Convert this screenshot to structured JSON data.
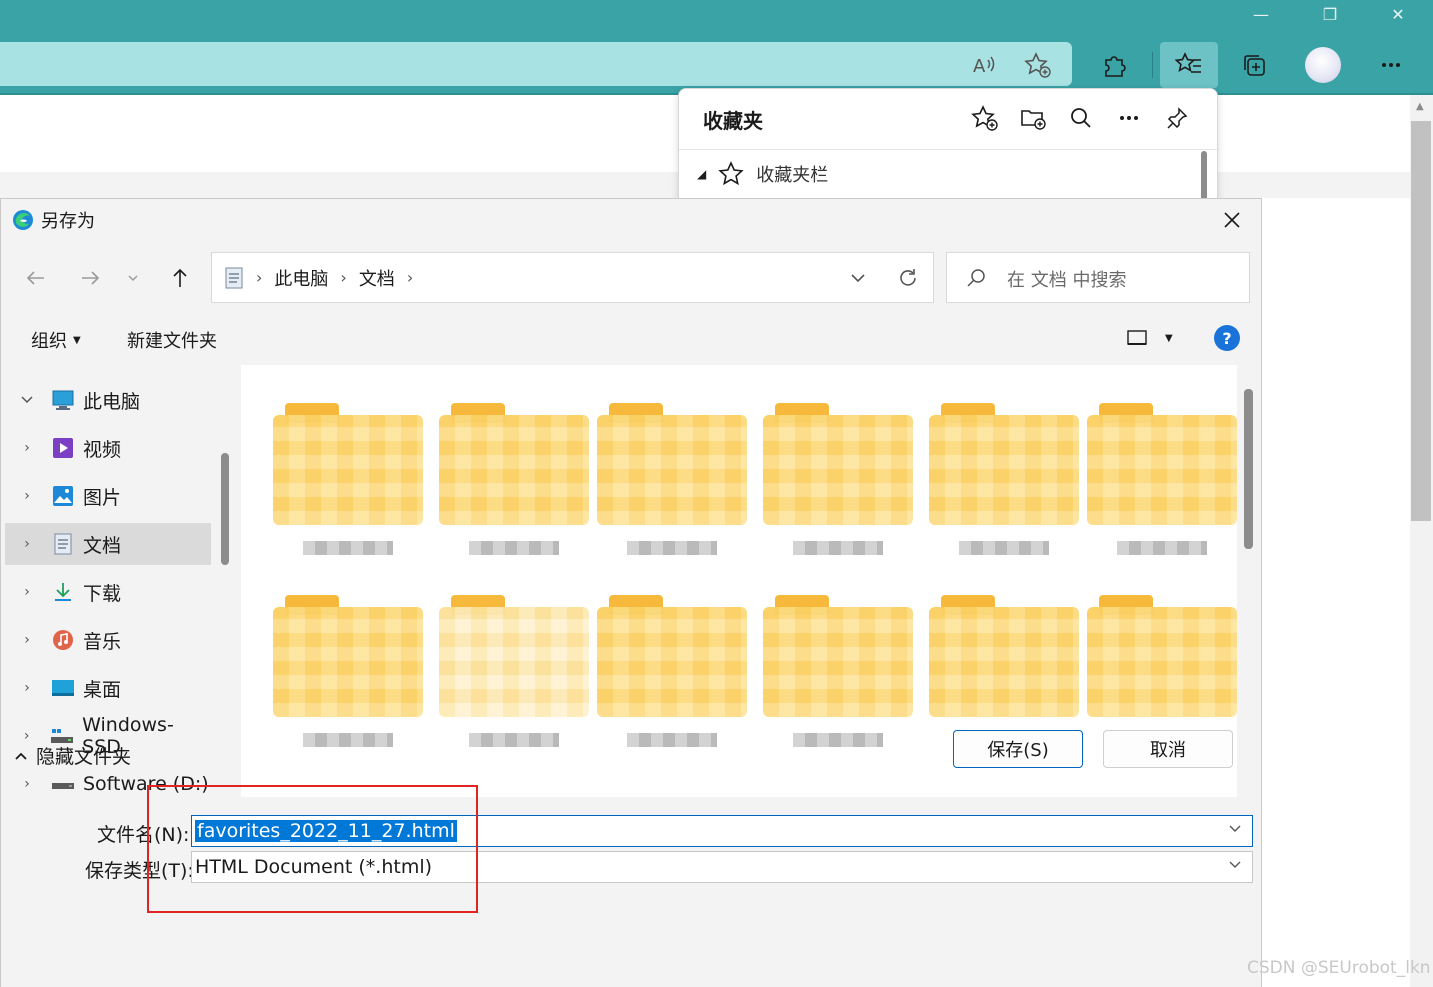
{
  "browser": {
    "window_controls": [
      "—",
      "❐",
      "✕"
    ],
    "toolbar_icons": [
      "read-aloud-icon",
      "add-favorite-icon",
      "extensions-icon",
      "favorites-icon",
      "collections-icon",
      "profile-avatar",
      "more-icon"
    ]
  },
  "favorites_panel": {
    "title": "收藏夹",
    "folder_name": "收藏夹栏"
  },
  "dialog": {
    "title": "另存为",
    "breadcrumb": [
      "此电脑",
      "文档"
    ],
    "search_placeholder": "在 文档 中搜索",
    "organize_label": "组织",
    "new_folder_label": "新建文件夹",
    "help_label": "?",
    "nav_items": [
      {
        "label": "此电脑",
        "icon": "pc-icon",
        "expanded": true
      },
      {
        "label": "视频",
        "icon": "video-folder-icon"
      },
      {
        "label": "图片",
        "icon": "pictures-folder-icon"
      },
      {
        "label": "文档",
        "icon": "documents-folder-icon",
        "selected": true
      },
      {
        "label": "下载",
        "icon": "downloads-folder-icon"
      },
      {
        "label": "音乐",
        "icon": "music-folder-icon"
      },
      {
        "label": "桌面",
        "icon": "desktop-folder-icon"
      },
      {
        "label": "Windows-SSD",
        "icon": "drive-icon"
      },
      {
        "label": "Software (D:)",
        "icon": "drive-icon"
      }
    ],
    "file_name_label": "文件名(N):",
    "file_name_value": "favorites_2022_11_27.html",
    "file_type_label": "保存类型(T):",
    "file_type_value": "HTML Document (*.html)",
    "hide_folders_label": "隐藏文件夹",
    "save_label": "保存(S)",
    "cancel_label": "取消"
  },
  "watermark": "CSDN @SEUrobot_lkn",
  "colors": {
    "chrome_teal": "#3aa3a6",
    "address_bar": "#a8e2e3",
    "accent_blue": "#0078d7",
    "highlight_red": "#e02424",
    "folder_yellow": "#fcd46a"
  }
}
